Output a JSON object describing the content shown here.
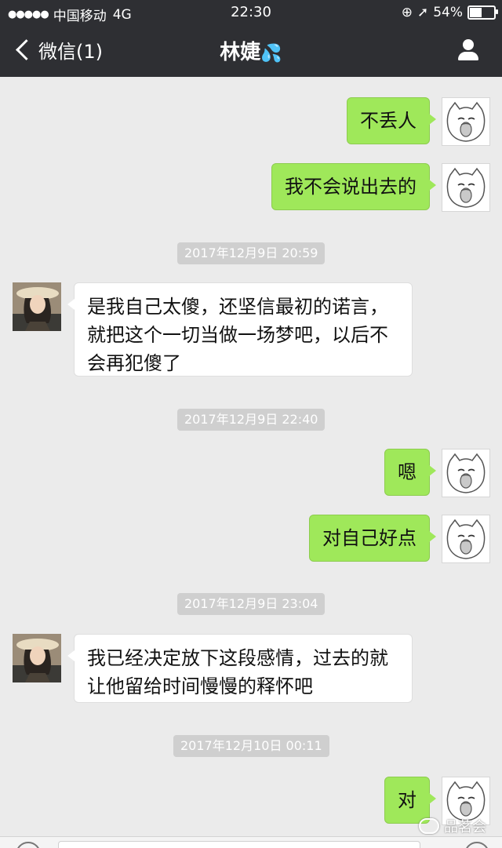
{
  "status_bar": {
    "signal": "●●●●●",
    "carrier": "中国移动",
    "network": "4G",
    "time": "22:30",
    "battery_text": "54%",
    "battery_level": 0.54
  },
  "nav": {
    "back_label": "微信(1)",
    "title": "林婕",
    "title_emoji": "💦"
  },
  "messages": [
    {
      "side": "right",
      "text": "不丢人"
    },
    {
      "side": "right",
      "text": "我不会说出去的"
    },
    {
      "type": "timestamp",
      "text": "2017年12月9日 20:59"
    },
    {
      "side": "left",
      "lines": [
        "是我自己太傻，还坚信最初的诺言，",
        "就把这个一切当做一场梦吧，以后不",
        "会再犯傻了"
      ]
    },
    {
      "type": "timestamp",
      "text": "2017年12月9日 22:40"
    },
    {
      "side": "right",
      "text": "嗯"
    },
    {
      "side": "right",
      "text": "对自己好点"
    },
    {
      "type": "timestamp",
      "text": "2017年12月9日 23:04"
    },
    {
      "side": "left",
      "lines": [
        "我已经决定放下这段感情，过去的就",
        "让他留给时间慢慢的释怀吧"
      ]
    },
    {
      "type": "timestamp",
      "text": "2017年12月10日 00:11"
    },
    {
      "side": "right",
      "text": "对"
    }
  ],
  "watermark": "品茗会",
  "colors": {
    "header_bg": "#2e2f33",
    "chat_bg": "#ebebeb",
    "sent_bubble": "#9fe85a",
    "received_bubble": "#ffffff",
    "timestamp_bg": "#cfcfcf"
  }
}
